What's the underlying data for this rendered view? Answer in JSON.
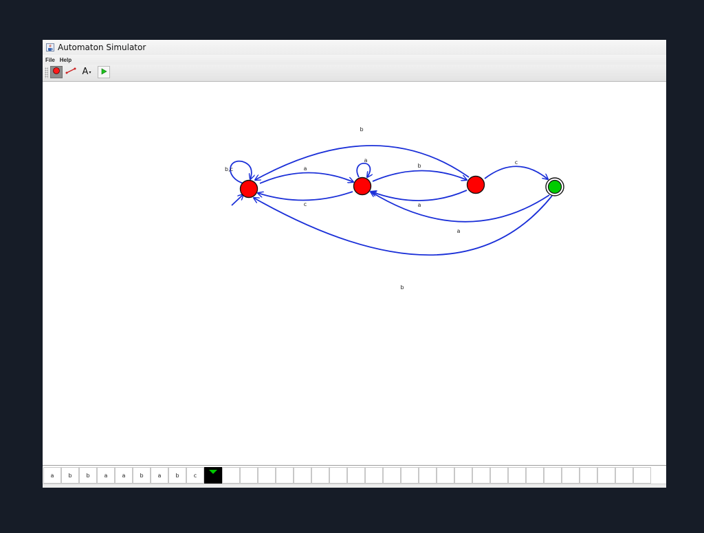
{
  "window": {
    "title": "Automaton Simulator",
    "icon": "java-coffee-icon"
  },
  "menu": {
    "items": [
      "File",
      "Help"
    ]
  },
  "toolbar": {
    "tools": [
      {
        "name": "add-state-tool",
        "icon": "red-circle-icon",
        "active": true
      },
      {
        "name": "add-transition-tool",
        "icon": "red-line-icon",
        "active": false
      },
      {
        "name": "add-text-tool",
        "icon": "letter-a-icon",
        "label": "A",
        "active": false
      },
      {
        "name": "run-tool",
        "icon": "green-play-icon",
        "active": false
      }
    ]
  },
  "colors": {
    "state": "#ff0000",
    "accepting_state": "#00cc00",
    "transition": "#1a2fd8",
    "head": "#00c800"
  },
  "automaton": {
    "states": [
      {
        "id": "q0",
        "type": "start"
      },
      {
        "id": "q1",
        "type": "normal"
      },
      {
        "id": "q2",
        "type": "normal"
      },
      {
        "id": "q3",
        "type": "accepting"
      }
    ],
    "transitions": [
      {
        "from": "q0",
        "to": "q0",
        "label": "b,c"
      },
      {
        "from": "q0",
        "to": "q1",
        "label": "a"
      },
      {
        "from": "q1",
        "to": "q0",
        "label": "c"
      },
      {
        "from": "q1",
        "to": "q1",
        "label": "a"
      },
      {
        "from": "q1",
        "to": "q2",
        "label": "b"
      },
      {
        "from": "q2",
        "to": "q1",
        "label": "a"
      },
      {
        "from": "q2",
        "to": "q0",
        "label": "b"
      },
      {
        "from": "q2",
        "to": "q3",
        "label": "c"
      },
      {
        "from": "q3",
        "to": "q1",
        "label": "a"
      },
      {
        "from": "q3",
        "to": "q0",
        "label": "b"
      }
    ]
  },
  "tape": {
    "symbols": [
      "a",
      "b",
      "b",
      "a",
      "a",
      "b",
      "a",
      "b",
      "c"
    ],
    "head_index": 9,
    "total_cells": 35
  }
}
